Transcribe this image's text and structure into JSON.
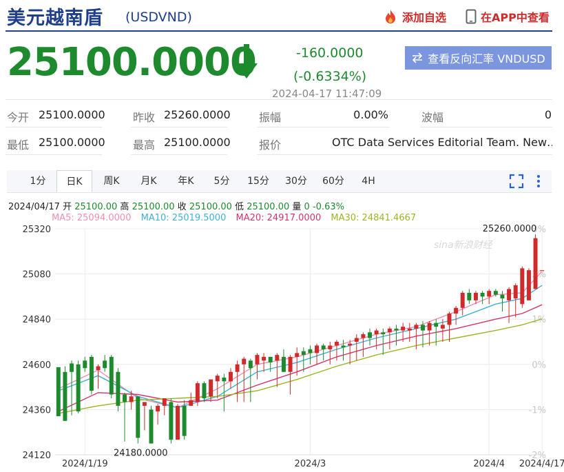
{
  "header": {
    "title": "美元越南盾",
    "code": "(USDVND)",
    "add_fav": "添加自选",
    "view_app": "在APP中查看"
  },
  "quote": {
    "price": "25100.0000",
    "change": "-160.0000",
    "change_pct": "(-0.6334%)",
    "timestamp": "2024-04-17 11:47:09",
    "reverse_button": "查看反向汇率 VNDUSD",
    "down_color": "#1e8a2e",
    "up_color": "#d02a2a"
  },
  "stats": {
    "open_label": "今开",
    "open": "25100.0000",
    "prev_label": "昨收",
    "prev": "25260.0000",
    "amp_label": "振幅",
    "amp": "0.00%",
    "wave_label": "波幅",
    "wave": "0",
    "low_label": "最低",
    "low": "25100.0000",
    "high_label": "最高",
    "high": "25100.0000",
    "quote_label": "报价",
    "quote_src": "OTC Data Services Editorial Team. New…"
  },
  "tabs": [
    "1分",
    "日K",
    "周K",
    "月K",
    "年K",
    "5分",
    "15分",
    "30分",
    "60分",
    "4H"
  ],
  "active_tab": "日K",
  "icons": [
    "fire-icon",
    "phone-icon",
    "swap-icon",
    "fullscreen-icon",
    "more-icon",
    "down-arrow-icon"
  ],
  "info_bar": {
    "date": "2024/04/17",
    "open_label": "开",
    "open": "25100.00",
    "high_label": "高",
    "high": "25100.00",
    "close_label": "收",
    "close": "25100.00",
    "low_label": "低",
    "low": "25100.00",
    "vol_label": "量",
    "vol": "0",
    "pct": "-0.63%"
  },
  "ma_legend": [
    {
      "text": "MA5: 25094.0000",
      "color": "#f08fae"
    },
    {
      "text": "MA10: 25019.5000",
      "color": "#3db1d6"
    },
    {
      "text": "MA20: 24917.0000",
      "color": "#d6336c"
    },
    {
      "text": "MA30: 24841.4667",
      "color": "#9bb624"
    }
  ],
  "watermark": "sina新浪财经",
  "chart_data": {
    "type": "candlestick",
    "x_ticks": [
      "2024/1/19",
      "2024/3",
      "2024/4",
      "2024/4/17"
    ],
    "y_ticks": [
      24120,
      24360,
      24600,
      24840,
      25080,
      25320
    ],
    "y_range": [
      24120,
      25320
    ],
    "right_ticks": [
      "3%",
      "2%",
      "1%",
      "0%",
      "-1%",
      "-2%"
    ],
    "max_label": "25260.0000",
    "min_label": "24180.0000",
    "candles": [
      [
        24585,
        24325,
        24585,
        24325
      ],
      [
        24560,
        24300,
        24590,
        24300
      ],
      [
        24605,
        24560,
        24620,
        24330
      ],
      [
        24600,
        24350,
        24620,
        24340
      ],
      [
        24620,
        24580,
        24640,
        24560
      ],
      [
        24640,
        24460,
        24650,
        24440
      ],
      [
        24570,
        24590,
        24600,
        24470
      ],
      [
        24620,
        24580,
        24650,
        24560
      ],
      [
        24640,
        24440,
        24650,
        24420
      ],
      [
        24560,
        24380,
        24580,
        24350
      ],
      [
        24440,
        24400,
        24450,
        24190
      ],
      [
        24400,
        24430,
        24460,
        24360
      ],
      [
        24430,
        24210,
        24430,
        24180
      ],
      [
        24380,
        24400,
        24400,
        24250
      ],
      [
        24360,
        24180,
        24380,
        24180
      ],
      [
        24350,
        24380,
        24390,
        24280
      ],
      [
        24380,
        24420,
        24420,
        24330
      ],
      [
        24400,
        24200,
        24420,
        24180
      ],
      [
        24200,
        24380,
        24390,
        24200
      ],
      [
        24380,
        24220,
        24410,
        24200
      ],
      [
        24380,
        24410,
        24450,
        24380
      ],
      [
        24400,
        24500,
        24510,
        24380
      ],
      [
        24500,
        24420,
        24510,
        24400
      ],
      [
        24430,
        24520,
        24520,
        24400
      ],
      [
        24510,
        24540,
        24550,
        24420
      ],
      [
        24530,
        24510,
        24550,
        24350
      ],
      [
        24510,
        24560,
        24580,
        24470
      ],
      [
        24560,
        24600,
        24620,
        24400
      ],
      [
        24600,
        24630,
        24640,
        24400
      ],
      [
        24620,
        24580,
        24630,
        24400
      ],
      [
        24600,
        24650,
        24660,
        24520
      ],
      [
        24620,
        24640,
        24660,
        24560
      ],
      [
        24640,
        24610,
        24640,
        24560
      ],
      [
        24620,
        24650,
        24660,
        24480
      ],
      [
        24640,
        24560,
        24680,
        24560
      ],
      [
        24560,
        24640,
        24650,
        24440
      ],
      [
        24640,
        24660,
        24690,
        24540
      ],
      [
        24670,
        24650,
        24690,
        24560
      ],
      [
        24680,
        24660,
        24700,
        24600
      ],
      [
        24660,
        24700,
        24710,
        24600
      ],
      [
        24700,
        24680,
        24710,
        24620
      ],
      [
        24680,
        24700,
        24720,
        24600
      ],
      [
        24700,
        24720,
        24730,
        24620
      ],
      [
        24700,
        24690,
        24730,
        24620
      ],
      [
        24700,
        24710,
        24730,
        24600
      ],
      [
        24720,
        24740,
        24760,
        24620
      ],
      [
        24740,
        24760,
        24770,
        24640
      ],
      [
        24770,
        24740,
        24790,
        24700
      ],
      [
        24760,
        24780,
        24790,
        24680
      ],
      [
        24770,
        24760,
        24790,
        24650
      ],
      [
        24770,
        24790,
        24800,
        24680
      ],
      [
        24790,
        24780,
        24810,
        24700
      ],
      [
        24780,
        24800,
        24820,
        24720
      ],
      [
        24780,
        24790,
        24820,
        24720
      ],
      [
        24790,
        24810,
        24820,
        24680
      ],
      [
        24810,
        24780,
        24830,
        24690
      ],
      [
        24780,
        24820,
        24830,
        24700
      ],
      [
        24820,
        24800,
        24840,
        24700
      ],
      [
        24790,
        24810,
        24840,
        24720
      ],
      [
        24810,
        24870,
        24880,
        24720
      ],
      [
        24870,
        24900,
        24910,
        24810
      ],
      [
        24900,
        24980,
        24990,
        24860
      ],
      [
        24980,
        24940,
        25000,
        24920
      ],
      [
        24940,
        24980,
        24990,
        24920
      ],
      [
        24980,
        24960,
        24990,
        24920
      ],
      [
        24960,
        24990,
        25000,
        24920
      ],
      [
        24990,
        24970,
        25000,
        24960
      ],
      [
        24970,
        24950,
        24990,
        24880
      ],
      [
        24940,
        25000,
        25010,
        24820
      ],
      [
        24950,
        25020,
        25030,
        24850
      ],
      [
        24920,
        25110,
        25120,
        24900
      ],
      [
        24940,
        25100,
        25110,
        24940
      ],
      [
        25000,
        25270,
        25290,
        25000
      ],
      [
        25100,
        25100,
        25100,
        25100
      ]
    ],
    "ma_series": {
      "ma5": [
        [
          0,
          24470
        ],
        [
          6,
          24570
        ],
        [
          12,
          24420
        ],
        [
          18,
          24370
        ],
        [
          24,
          24470
        ],
        [
          30,
          24600
        ],
        [
          36,
          24640
        ],
        [
          42,
          24700
        ],
        [
          48,
          24760
        ],
        [
          54,
          24800
        ],
        [
          60,
          24880
        ],
        [
          66,
          24970
        ],
        [
          70,
          24980
        ],
        [
          73,
          25094
        ]
      ],
      "ma10": [
        [
          0,
          24460
        ],
        [
          6,
          24540
        ],
        [
          12,
          24430
        ],
        [
          18,
          24370
        ],
        [
          24,
          24430
        ],
        [
          30,
          24560
        ],
        [
          36,
          24610
        ],
        [
          42,
          24680
        ],
        [
          48,
          24740
        ],
        [
          54,
          24790
        ],
        [
          60,
          24840
        ],
        [
          66,
          24920
        ],
        [
          70,
          24950
        ],
        [
          73,
          25019.5
        ]
      ],
      "ma20": [
        [
          0,
          24350
        ],
        [
          6,
          24450
        ],
        [
          12,
          24440
        ],
        [
          18,
          24400
        ],
        [
          24,
          24410
        ],
        [
          30,
          24490
        ],
        [
          36,
          24560
        ],
        [
          42,
          24640
        ],
        [
          48,
          24700
        ],
        [
          54,
          24750
        ],
        [
          60,
          24790
        ],
        [
          66,
          24840
        ],
        [
          70,
          24870
        ],
        [
          73,
          24917
        ]
      ],
      "ma30": [
        [
          0,
          24340
        ],
        [
          6,
          24380
        ],
        [
          12,
          24410
        ],
        [
          18,
          24420
        ],
        [
          24,
          24430
        ],
        [
          30,
          24460
        ],
        [
          36,
          24520
        ],
        [
          42,
          24590
        ],
        [
          48,
          24650
        ],
        [
          54,
          24700
        ],
        [
          60,
          24740
        ],
        [
          66,
          24780
        ],
        [
          70,
          24810
        ],
        [
          73,
          24841.4667
        ]
      ]
    }
  }
}
